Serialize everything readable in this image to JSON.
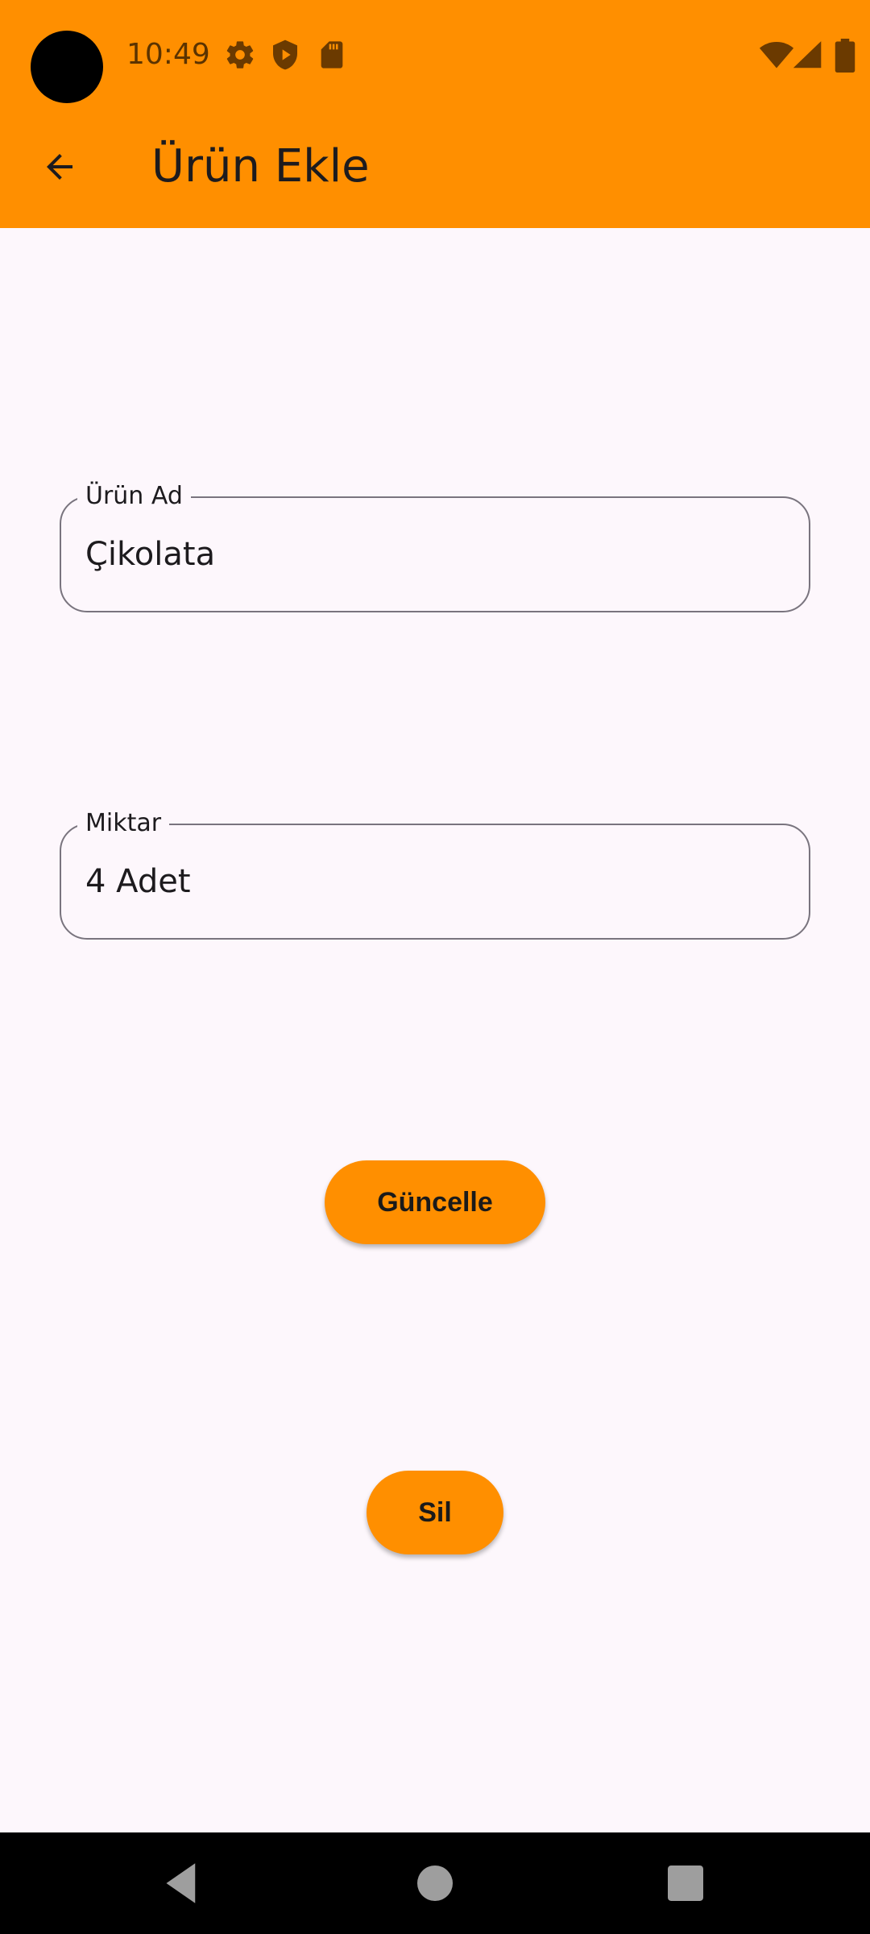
{
  "status_bar": {
    "time": "10:49",
    "left_icons": [
      "gear-icon",
      "shield-play-icon",
      "sd-card-icon"
    ],
    "right_icons": [
      "wifi-icon",
      "signal-icon",
      "battery-icon"
    ]
  },
  "toolbar": {
    "title": "Ürün Ekle",
    "back_icon": "arrow-back-icon"
  },
  "form": {
    "product_name": {
      "label": "Ürün Ad",
      "value": "Çikolata"
    },
    "quantity": {
      "label": "Miktar",
      "value": "4 Adet"
    }
  },
  "buttons": {
    "update_label": "Güncelle",
    "delete_label": "Sil"
  },
  "nav_bar": {
    "buttons": [
      "back-triangle-icon",
      "home-circle-icon",
      "recents-square-icon"
    ]
  },
  "colors": {
    "accent": "#FF8F00",
    "background": "#FDF7FC",
    "nav_background": "#000000"
  }
}
